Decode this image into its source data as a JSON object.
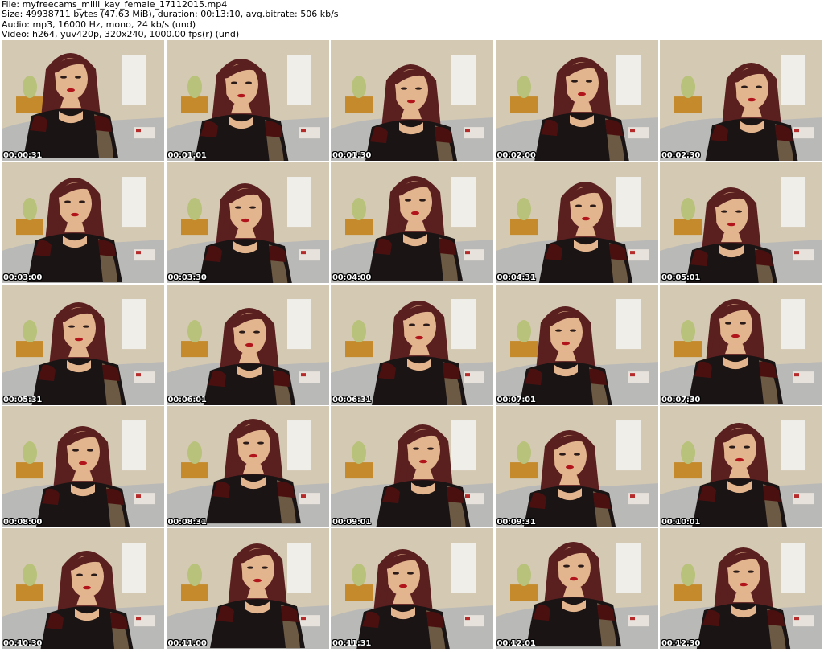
{
  "header": {
    "file_line": "File: myfreecams_milli_kay_female_17112015.mp4",
    "size_line": "Size: 49938711 bytes (47.63 MiB), duration: 00:13:10, avg.bitrate: 506 kb/s",
    "audio_line": "Audio: mp3, 16000 Hz, mono, 24 kb/s (und)",
    "video_line": "Video: h264, yuv420p, 320x240, 1000.00 fps(r) (und)"
  },
  "thumbnails": [
    {
      "timestamp": "00:00:31"
    },
    {
      "timestamp": "00:01:01"
    },
    {
      "timestamp": "00:01:30"
    },
    {
      "timestamp": "00:02:00"
    },
    {
      "timestamp": "00:02:30"
    },
    {
      "timestamp": "00:03:00"
    },
    {
      "timestamp": "00:03:30"
    },
    {
      "timestamp": "00:04:00"
    },
    {
      "timestamp": "00:04:31"
    },
    {
      "timestamp": "00:05:01"
    },
    {
      "timestamp": "00:05:31"
    },
    {
      "timestamp": "00:06:01"
    },
    {
      "timestamp": "00:06:31"
    },
    {
      "timestamp": "00:07:01"
    },
    {
      "timestamp": "00:07:30"
    },
    {
      "timestamp": "00:08:00"
    },
    {
      "timestamp": "00:08:31"
    },
    {
      "timestamp": "00:09:01"
    },
    {
      "timestamp": "00:09:31"
    },
    {
      "timestamp": "00:10:01"
    },
    {
      "timestamp": "00:10:30"
    },
    {
      "timestamp": "00:11:00"
    },
    {
      "timestamp": "00:11:31"
    },
    {
      "timestamp": "00:12:01"
    },
    {
      "timestamp": "00:12:30"
    }
  ],
  "colors": {
    "wall": "#d4c9b2",
    "bed": "#b9b9b7",
    "hair": "#5a1f1f",
    "skin": "#e3b58f",
    "top": "#1a1414",
    "lamp": "#b8c27a"
  }
}
